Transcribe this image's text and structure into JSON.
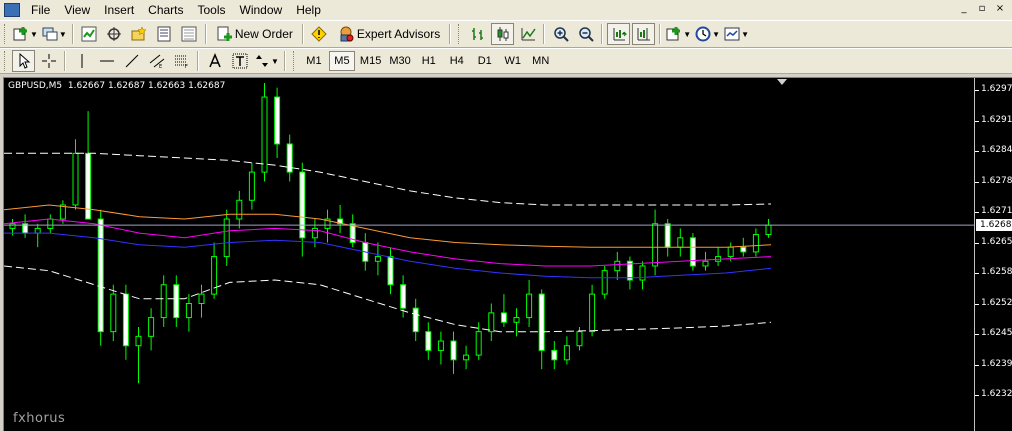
{
  "menu": {
    "items": [
      "File",
      "View",
      "Insert",
      "Charts",
      "Tools",
      "Window",
      "Help"
    ],
    "window_controls": [
      "_",
      "▫",
      "×"
    ]
  },
  "toolbar": {
    "new_order_label": "New Order",
    "expert_advisors_label": "Expert Advisors"
  },
  "timeframes": {
    "items": [
      "M1",
      "M5",
      "M15",
      "M30",
      "H1",
      "H4",
      "D1",
      "W1",
      "MN"
    ],
    "selected": "M5"
  },
  "chart": {
    "symbol_header": "GBPUSD,M5  1.62667 1.62687 1.62663 1.62687",
    "current_price": "1.62687",
    "watermark": "fxhorus",
    "colors": {
      "background": "#000000",
      "bull_candle": "#00ff00",
      "bear_candle": "#ffffff",
      "upper_envelope": "#ffffff",
      "lower_envelope": "#ffffff",
      "ma_orange": "#ff9933",
      "ma_magenta": "#ff00ff",
      "ma_blue": "#3333ff",
      "bid_line": "#a0a0c8"
    }
  },
  "chart_data": {
    "type": "candlestick",
    "symbol": "GBPUSD",
    "timeframe": "M5",
    "last": {
      "open": 1.62667,
      "high": 1.62687,
      "low": 1.62663,
      "close": 1.62687
    },
    "ylim": [
      1.62325,
      1.63
    ],
    "y_ticks": [
      "1.62975",
      "1.62910",
      "1.62845",
      "1.62780",
      "1.62715",
      "1.62650",
      "1.62585",
      "1.62520",
      "1.62455",
      "1.62390",
      "1.62325"
    ],
    "series": [
      {
        "kind": "ohlc",
        "values": [
          [
            1.6268,
            1.627,
            1.62665,
            1.6269
          ],
          [
            1.6269,
            1.6271,
            1.6266,
            1.6267
          ],
          [
            1.6267,
            1.6269,
            1.6264,
            1.6268
          ],
          [
            1.6268,
            1.6271,
            1.6267,
            1.627
          ],
          [
            1.627,
            1.6274,
            1.6269,
            1.6273
          ],
          [
            1.6273,
            1.6287,
            1.6272,
            1.6284
          ],
          [
            1.6284,
            1.6293,
            1.6281,
            1.627
          ],
          [
            1.627,
            1.6272,
            1.6243,
            1.6246
          ],
          [
            1.6246,
            1.6256,
            1.6244,
            1.6254
          ],
          [
            1.6254,
            1.6256,
            1.624,
            1.6243
          ],
          [
            1.6243,
            1.6247,
            1.6235,
            1.6245
          ],
          [
            1.6245,
            1.6251,
            1.6242,
            1.6249
          ],
          [
            1.6249,
            1.6258,
            1.6247,
            1.6256
          ],
          [
            1.6256,
            1.6258,
            1.6247,
            1.6249
          ],
          [
            1.6249,
            1.6254,
            1.6246,
            1.6252
          ],
          [
            1.6252,
            1.6256,
            1.6249,
            1.6254
          ],
          [
            1.6254,
            1.6265,
            1.6253,
            1.6262
          ],
          [
            1.6262,
            1.6272,
            1.626,
            1.627
          ],
          [
            1.627,
            1.6276,
            1.6268,
            1.6274
          ],
          [
            1.6274,
            1.6282,
            1.6272,
            1.628
          ],
          [
            1.628,
            1.6299,
            1.6278,
            1.6296
          ],
          [
            1.6296,
            1.6298,
            1.6283,
            1.6286
          ],
          [
            1.6286,
            1.6288,
            1.6278,
            1.628
          ],
          [
            1.628,
            1.6282,
            1.6262,
            1.6266
          ],
          [
            1.6266,
            1.627,
            1.6264,
            1.6268
          ],
          [
            1.6268,
            1.6272,
            1.6265,
            1.627
          ],
          [
            1.627,
            1.6273,
            1.6267,
            1.6269
          ],
          [
            1.6269,
            1.6271,
            1.6264,
            1.6265
          ],
          [
            1.6265,
            1.6267,
            1.6259,
            1.6261
          ],
          [
            1.6261,
            1.6265,
            1.6258,
            1.6262
          ],
          [
            1.6262,
            1.6264,
            1.6254,
            1.6256
          ],
          [
            1.6256,
            1.6258,
            1.6249,
            1.6251
          ],
          [
            1.6251,
            1.6253,
            1.6244,
            1.6246
          ],
          [
            1.6246,
            1.6248,
            1.624,
            1.6242
          ],
          [
            1.6242,
            1.6246,
            1.6239,
            1.6244
          ],
          [
            1.6244,
            1.6246,
            1.6237,
            1.624
          ],
          [
            1.624,
            1.6243,
            1.6238,
            1.6241
          ],
          [
            1.6241,
            1.6248,
            1.624,
            1.6246
          ],
          [
            1.6246,
            1.6252,
            1.6244,
            1.625
          ],
          [
            1.625,
            1.6254,
            1.6247,
            1.6248
          ],
          [
            1.6248,
            1.6251,
            1.6245,
            1.6249
          ],
          [
            1.6249,
            1.6257,
            1.6247,
            1.6254
          ],
          [
            1.6254,
            1.6255,
            1.6238,
            1.6242
          ],
          [
            1.6242,
            1.6244,
            1.6238,
            1.624
          ],
          [
            1.624,
            1.6245,
            1.6239,
            1.6243
          ],
          [
            1.6243,
            1.6247,
            1.6242,
            1.6246
          ],
          [
            1.6246,
            1.6256,
            1.6245,
            1.6254
          ],
          [
            1.6254,
            1.626,
            1.6253,
            1.6259
          ],
          [
            1.6259,
            1.6263,
            1.6257,
            1.6261
          ],
          [
            1.6261,
            1.6262,
            1.6255,
            1.6257
          ],
          [
            1.6257,
            1.6261,
            1.6255,
            1.626
          ],
          [
            1.626,
            1.6272,
            1.6258,
            1.6269
          ],
          [
            1.6269,
            1.627,
            1.6262,
            1.6264
          ],
          [
            1.6264,
            1.6268,
            1.6262,
            1.6266
          ],
          [
            1.6266,
            1.6267,
            1.6259,
            1.626
          ],
          [
            1.626,
            1.6263,
            1.6259,
            1.6261
          ],
          [
            1.6261,
            1.6264,
            1.626,
            1.6262
          ],
          [
            1.6262,
            1.6265,
            1.6261,
            1.6264
          ],
          [
            1.6264,
            1.6266,
            1.6262,
            1.6263
          ],
          [
            1.6263,
            1.6268,
            1.6262,
            1.62667
          ],
          [
            1.62667,
            1.627,
            1.6266,
            1.62687
          ]
        ]
      },
      {
        "kind": "line",
        "name": "",
        "color": "#ffffff",
        "dashed": true,
        "values": [
          1.6284,
          1.6284,
          1.6284,
          1.62835,
          1.6283,
          1.62825,
          1.62815,
          1.628,
          1.6278,
          1.6276,
          1.62745,
          1.62735,
          1.6273,
          1.6273,
          1.6273,
          1.6273,
          1.6273,
          1.62732
        ]
      },
      {
        "kind": "line",
        "name": "",
        "color": "#ff9933",
        "values": [
          1.6272,
          1.6273,
          1.6272,
          1.62705,
          1.627,
          1.6271,
          1.6271,
          1.627,
          1.6268,
          1.6266,
          1.6265,
          1.62645,
          1.62642,
          1.6264,
          1.6264,
          1.6264,
          1.6264,
          1.62645
        ]
      },
      {
        "kind": "line",
        "name": "",
        "color": "#ff00ff",
        "values": [
          1.6269,
          1.627,
          1.6269,
          1.6267,
          1.6266,
          1.62675,
          1.6268,
          1.62675,
          1.6265,
          1.6263,
          1.62615,
          1.62605,
          1.626,
          1.626,
          1.62605,
          1.6261,
          1.62615,
          1.6262
        ]
      },
      {
        "kind": "line",
        "name": "",
        "color": "#3333ff",
        "values": [
          1.6267,
          1.6267,
          1.6266,
          1.62645,
          1.6264,
          1.6265,
          1.62655,
          1.6265,
          1.6263,
          1.6261,
          1.62595,
          1.62585,
          1.62578,
          1.62575,
          1.62575,
          1.6258,
          1.62585,
          1.62595
        ]
      },
      {
        "kind": "line",
        "name": "",
        "color": "#ffffff",
        "dashed": true,
        "values": [
          1.626,
          1.6259,
          1.6256,
          1.6253,
          1.6253,
          1.62565,
          1.6257,
          1.6256,
          1.6253,
          1.625,
          1.62475,
          1.6246,
          1.6246,
          1.62462,
          1.62465,
          1.62468,
          1.62472,
          1.6248
        ]
      }
    ]
  }
}
